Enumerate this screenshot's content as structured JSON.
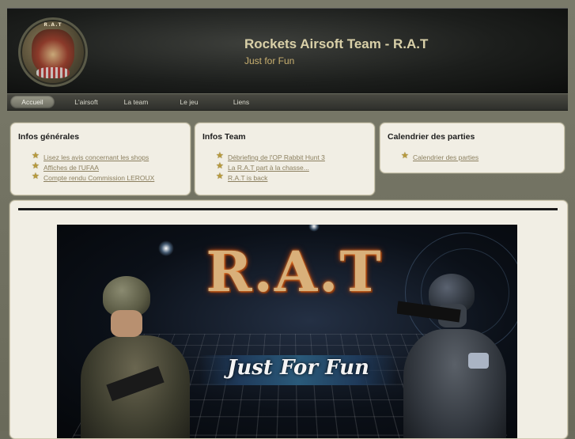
{
  "header": {
    "title": "Rockets Airsoft Team - R.A.T",
    "slogan": "Just for Fun",
    "logo_icon": "rat-team-badge-icon",
    "logo_text": "R.A.T"
  },
  "nav": {
    "items": [
      {
        "label": "Accueil",
        "active": true
      },
      {
        "label": "L'airsoft",
        "active": false
      },
      {
        "label": "La team",
        "active": false
      },
      {
        "label": "Le jeu",
        "active": false
      },
      {
        "label": "Liens",
        "active": false
      }
    ]
  },
  "boxes": [
    {
      "title": "Infos générales",
      "links": [
        "Lisez les avis concernant les shops",
        "Affiches de l'UFAA",
        "Compte rendu Commission LEROUX"
      ]
    },
    {
      "title": "Infos Team",
      "links": [
        "Débriefing de l'OP Rabbit Hunt 3",
        "La R.A.T part à la chasse...",
        "R.A.T is back"
      ]
    },
    {
      "title": "Calendrier des parties",
      "links": [
        "Calendrier des parties"
      ]
    }
  ],
  "banner": {
    "title": "R.A.T",
    "tagline": "Just For Fun"
  },
  "colors": {
    "header_bg": "#1c1e1c",
    "title": "#d9d0a8",
    "slogan": "#c9b070",
    "box_bg": "#f1eee4",
    "link": "#8c8060",
    "star": "#b89a3c"
  }
}
